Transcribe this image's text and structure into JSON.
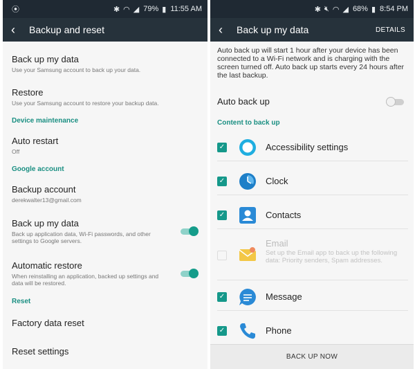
{
  "left": {
    "status": {
      "battery": "79%",
      "time": "11:55 AM"
    },
    "title": "Backup and reset",
    "items": {
      "backup_my_data": {
        "title": "Back up my data",
        "sub": "Use your Samsung account to back up your data."
      },
      "restore": {
        "title": "Restore",
        "sub": "Use your Samsung account to restore your backup data."
      },
      "auto_restart": {
        "title": "Auto restart",
        "sub": "Off"
      },
      "backup_account": {
        "title": "Backup account",
        "sub": "derekwalter13@gmail.com"
      },
      "google_backup": {
        "title": "Back up my data",
        "sub": "Back up application data, Wi-Fi passwords, and other settings to Google servers.",
        "checked": true
      },
      "auto_restore": {
        "title": "Automatic restore",
        "sub": "When reinstalling an application, backed up settings and data will be restored.",
        "checked": true
      },
      "factory_reset": {
        "title": "Factory data reset"
      },
      "reset_settings": {
        "title": "Reset settings"
      }
    },
    "sections": {
      "device_maintenance": "Device maintenance",
      "google_account": "Google account",
      "reset": "Reset"
    }
  },
  "right": {
    "status": {
      "battery": "68%",
      "time": "8:54 PM"
    },
    "title": "Back up my data",
    "action": "DETAILS",
    "intro": "Auto back up will start 1 hour after your device has been connected to a Wi-Fi network and is charging with the screen turned off. Auto back up starts every 24 hours after the last backup.",
    "auto_backup": {
      "label": "Auto back up",
      "checked": false
    },
    "section": "Content to back up",
    "apps": [
      {
        "label": "Accessibility settings",
        "checked": true,
        "icon": "accessibility-icon"
      },
      {
        "label": "Clock",
        "checked": true,
        "icon": "clock-icon"
      },
      {
        "label": "Contacts",
        "checked": true,
        "icon": "contacts-icon"
      },
      {
        "label": "Email",
        "checked": false,
        "disabled": true,
        "icon": "email-icon",
        "sub": "Set up the Email app to back up the following data: Priority senders, Spam addresses."
      },
      {
        "label": "Message",
        "checked": true,
        "icon": "message-icon"
      },
      {
        "label": "Phone",
        "checked": true,
        "icon": "phone-icon"
      }
    ],
    "button": "BACK UP NOW"
  },
  "colors": {
    "accent": "#159c8a",
    "appbar": "#26323b",
    "statusbar": "#1f2933"
  }
}
